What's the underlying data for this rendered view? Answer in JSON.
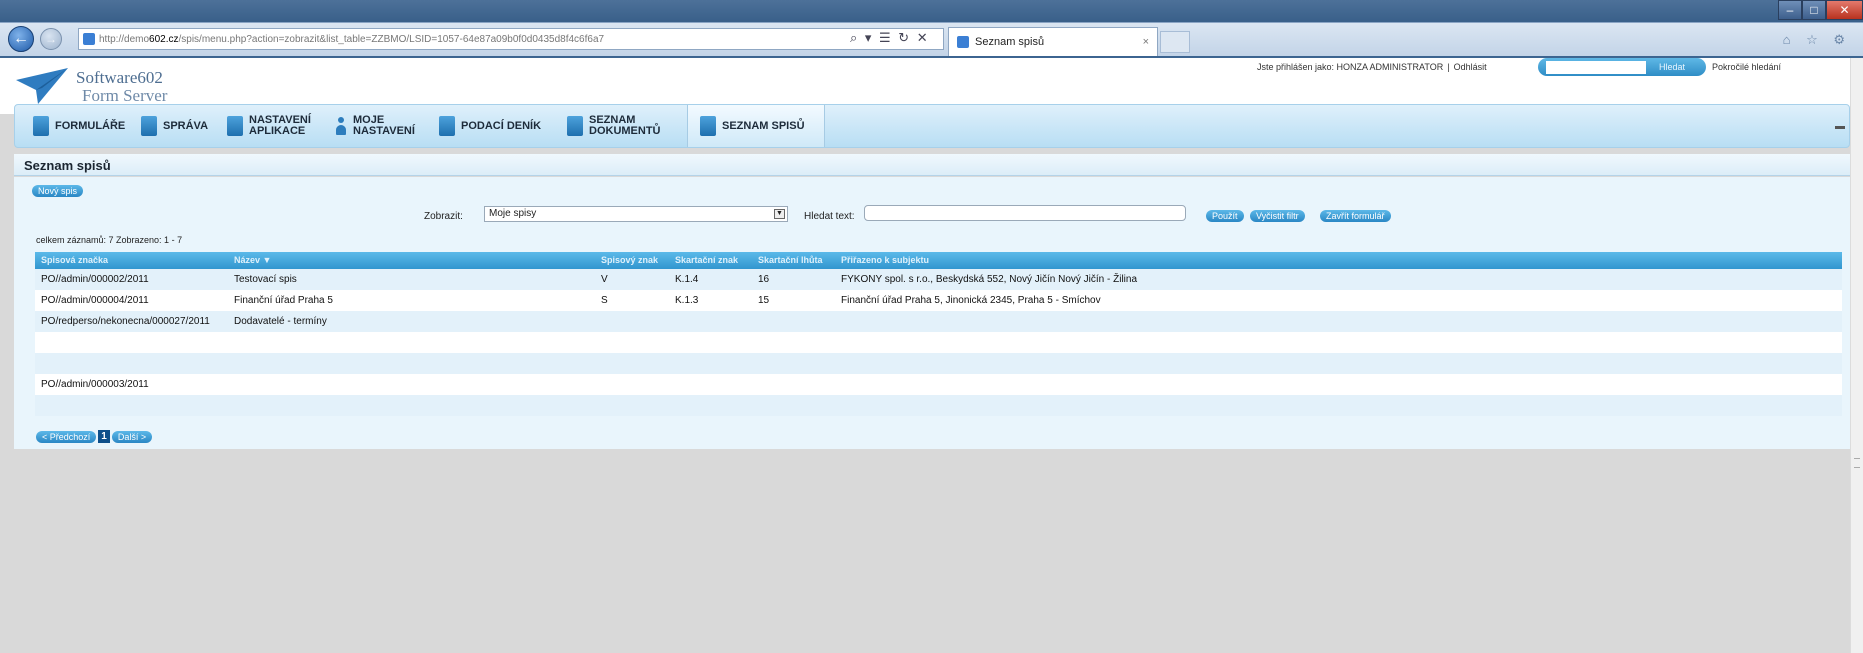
{
  "browser": {
    "url_prefix": "http://demo",
    "url_domain": "602.cz",
    "url_rest": "/spis/menu.php?action=zobrazit&list_table=ZZBMO/LSID=1057-64e87a09b0f0d0435d8f4c6f6a7",
    "tab_title": "Seznam spisů",
    "tab_close": "×"
  },
  "header": {
    "logo_line1": "Software602",
    "logo_line2": "Form Server",
    "logged_in_text": "Jste přihlášen jako: HONZA ADMINISTRATOR",
    "logout": "Odhlásit",
    "search_button": "Hledat",
    "advanced_search": "Pokročilé hledání"
  },
  "nav": {
    "items": [
      {
        "line1": "FORMULÁŘE",
        "line2": ""
      },
      {
        "line1": "SPRÁVA",
        "line2": ""
      },
      {
        "line1": "NASTAVENÍ",
        "line2": "APLIKACE"
      },
      {
        "line1": "MOJE",
        "line2": "NASTAVENÍ"
      },
      {
        "line1": "PODACÍ DENÍK",
        "line2": ""
      },
      {
        "line1": "SEZNAM",
        "line2": "DOKUMENTŮ"
      },
      {
        "line1": "SEZNAM SPISŮ",
        "line2": ""
      }
    ]
  },
  "page": {
    "title": "Seznam spisů",
    "new_button": "Nový spis",
    "filter_label": "Zobrazit:",
    "filter_value": "Moje spisy",
    "search_label": "Hledat text:",
    "use_button": "Použít",
    "clear_button": "Vyčistit filtr",
    "close_button": "Zavřít formulář",
    "totals": "celkem záznamů: 7   Zobrazeno: 1 - 7"
  },
  "table": {
    "columns": [
      "Spisová značka",
      "Název ▼",
      "Spisový znak",
      "Skartační znak",
      "Skartační lhůta",
      "Přiřazeno k subjektu"
    ],
    "rows": [
      [
        "PO//admin/000002/2011",
        "Testovací spis",
        "V",
        "K.1.4",
        "16",
        "FYKONY spol. s r.o., Beskydská 552, Nový Jičín Nový Jičín - Žilina"
      ],
      [
        "PO//admin/000004/2011",
        "Finanční úřad Praha 5",
        "S",
        "K.1.3",
        "15",
        "Finanční úřad Praha 5, Jinonická 2345, Praha 5 - Smíchov"
      ],
      [
        "PO/redperso/nekonecna/000027/2011",
        "Dodavatelé - termíny",
        "",
        "",
        "",
        ""
      ],
      [
        "",
        "",
        "",
        "",
        "",
        ""
      ],
      [
        "",
        "",
        "",
        "",
        "",
        ""
      ],
      [
        "PO//admin/000003/2011",
        "",
        "",
        "",
        "",
        ""
      ],
      [
        "",
        "",
        "",
        "",
        "",
        ""
      ]
    ]
  },
  "pager": {
    "prev": "< Předchozí",
    "current": "1",
    "next": "Další >"
  },
  "colors": {
    "accent": "#2a87c4",
    "nav_bg": "#cde8f7",
    "content_bg": "#e9f5fc",
    "page_bg": "#d9d9d9"
  }
}
